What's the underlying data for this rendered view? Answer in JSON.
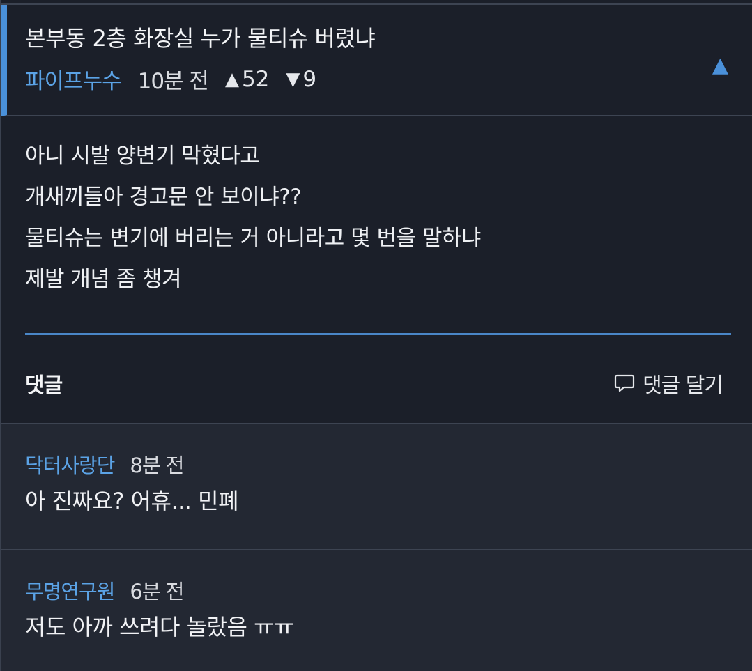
{
  "post": {
    "title": "본부동 2층 화장실 누가 물티슈 버렸냐",
    "author": "파이프누수",
    "time": "10분 전",
    "upvote_glyph": "▲",
    "upvotes": "52",
    "downvote_glyph": "▼",
    "downvotes": "9",
    "collapse_glyph": "▲",
    "body_lines": [
      "아니 시발 양변기 막혔다고",
      "개새끼들아 경고문 안 보이냐??",
      "물티슈는 변기에 버리는 거 아니라고 몇 번을 말하냐",
      "제발 개념 좀 챙겨"
    ]
  },
  "comments_section": {
    "title": "댓글",
    "add_label": "댓글 달기",
    "add_icon": "speech-bubble-icon"
  },
  "comments": [
    {
      "author": "닥터사랑단",
      "time": "8분 전",
      "text": "아 진짜요? 어휴... 민폐"
    },
    {
      "author": "무명연구원",
      "time": "6분 전",
      "text": "저도 아까 쓰려다 놀랐음 ㅠㅠ"
    }
  ],
  "colors": {
    "background": "#1b1f29",
    "comment_background": "#232833",
    "accent": "#4a90d9",
    "author": "#5ba3e6"
  }
}
